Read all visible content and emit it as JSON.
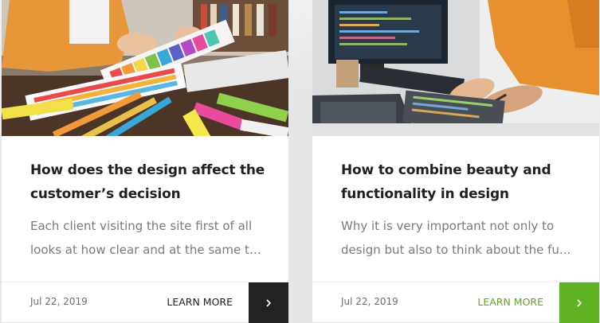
{
  "cards": [
    {
      "image_label": "designer-color-swatches-photo",
      "title_line1": "How does the design affect the",
      "title_line2": "customer’s decision",
      "excerpt_line1": "Each client visiting the site first of all",
      "excerpt_line2": "looks at how clear and at the same ti...",
      "date": "Jul 22, 2019",
      "learn_more": "LEARN MORE",
      "arrow_icon": "chevron-right-icon",
      "accent": "#222222"
    },
    {
      "image_label": "developers-laptop-code-photo",
      "title_line1": "How to combine beauty and",
      "title_line2": "functionality in design",
      "excerpt_line1": "Why it is very important not only to",
      "excerpt_line2": "design but also to think about the fu...",
      "date": "Jul 22, 2019",
      "learn_more": "LEARN MORE",
      "arrow_icon": "chevron-right-icon",
      "accent": "#5fb221"
    }
  ]
}
